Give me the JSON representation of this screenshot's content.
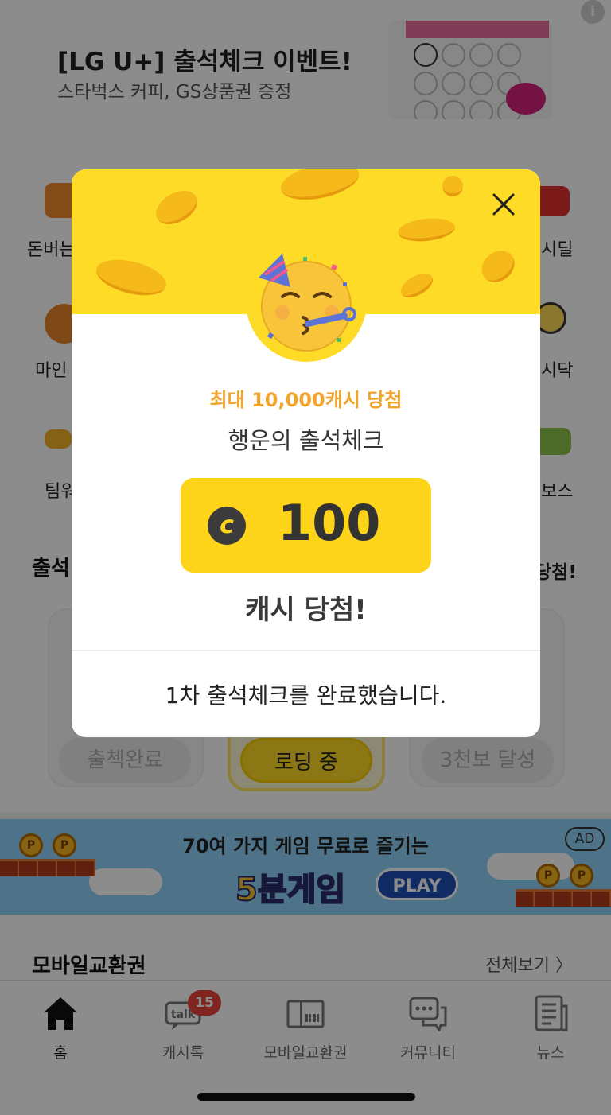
{
  "top_banner": {
    "title": "[LG U+] 출석체크 이벤트!",
    "subtitle": "스타벅스 커피, GS상품권 증정",
    "info_icon": "i"
  },
  "menu": {
    "items": [
      {
        "label": "돈버는",
        "icon": "money-icon"
      },
      {
        "label": "시딜",
        "icon": "cash-deal-icon"
      },
      {
        "label": "마인",
        "icon": "heart-icon"
      },
      {
        "label": "시닥",
        "icon": "pill-icon"
      },
      {
        "label": "팀워",
        "icon": "team-icon"
      },
      {
        "label": "보스",
        "icon": "boss-icon"
      }
    ]
  },
  "attendance": {
    "section_title": "출석",
    "right_label": "당첨!",
    "done_label": "출첵완료",
    "loading_label": "로딩 중",
    "achieve_label": "3천보 달성"
  },
  "ad": {
    "line1": "70여 가지 게임 무료로 즐기는",
    "line2": "5분게임",
    "play": "PLAY",
    "badge": "AD",
    "coin": "P"
  },
  "exchange": {
    "title": "모바일교환권",
    "view_all": "전체보기 〉"
  },
  "nav": {
    "items": [
      {
        "label": "홈",
        "icon": "home-icon",
        "active": true
      },
      {
        "label": "캐시톡",
        "icon": "talk-icon",
        "badge": "15"
      },
      {
        "label": "모바일교환권",
        "icon": "voucher-icon"
      },
      {
        "label": "커뮤니티",
        "icon": "community-icon"
      },
      {
        "label": "뉴스",
        "icon": "news-icon"
      }
    ]
  },
  "modal": {
    "promo": "최대 10,000캐시 당첨",
    "title": "행운의 출석체크",
    "cash_symbol": "c",
    "amount": "100",
    "win_text": "캐시 당첨!",
    "footer": "1차 출석체크를 완료했습니다.",
    "colors": {
      "header": "#fddb27",
      "promo": "#f2a52c",
      "cash_box": "#fdd419"
    }
  }
}
